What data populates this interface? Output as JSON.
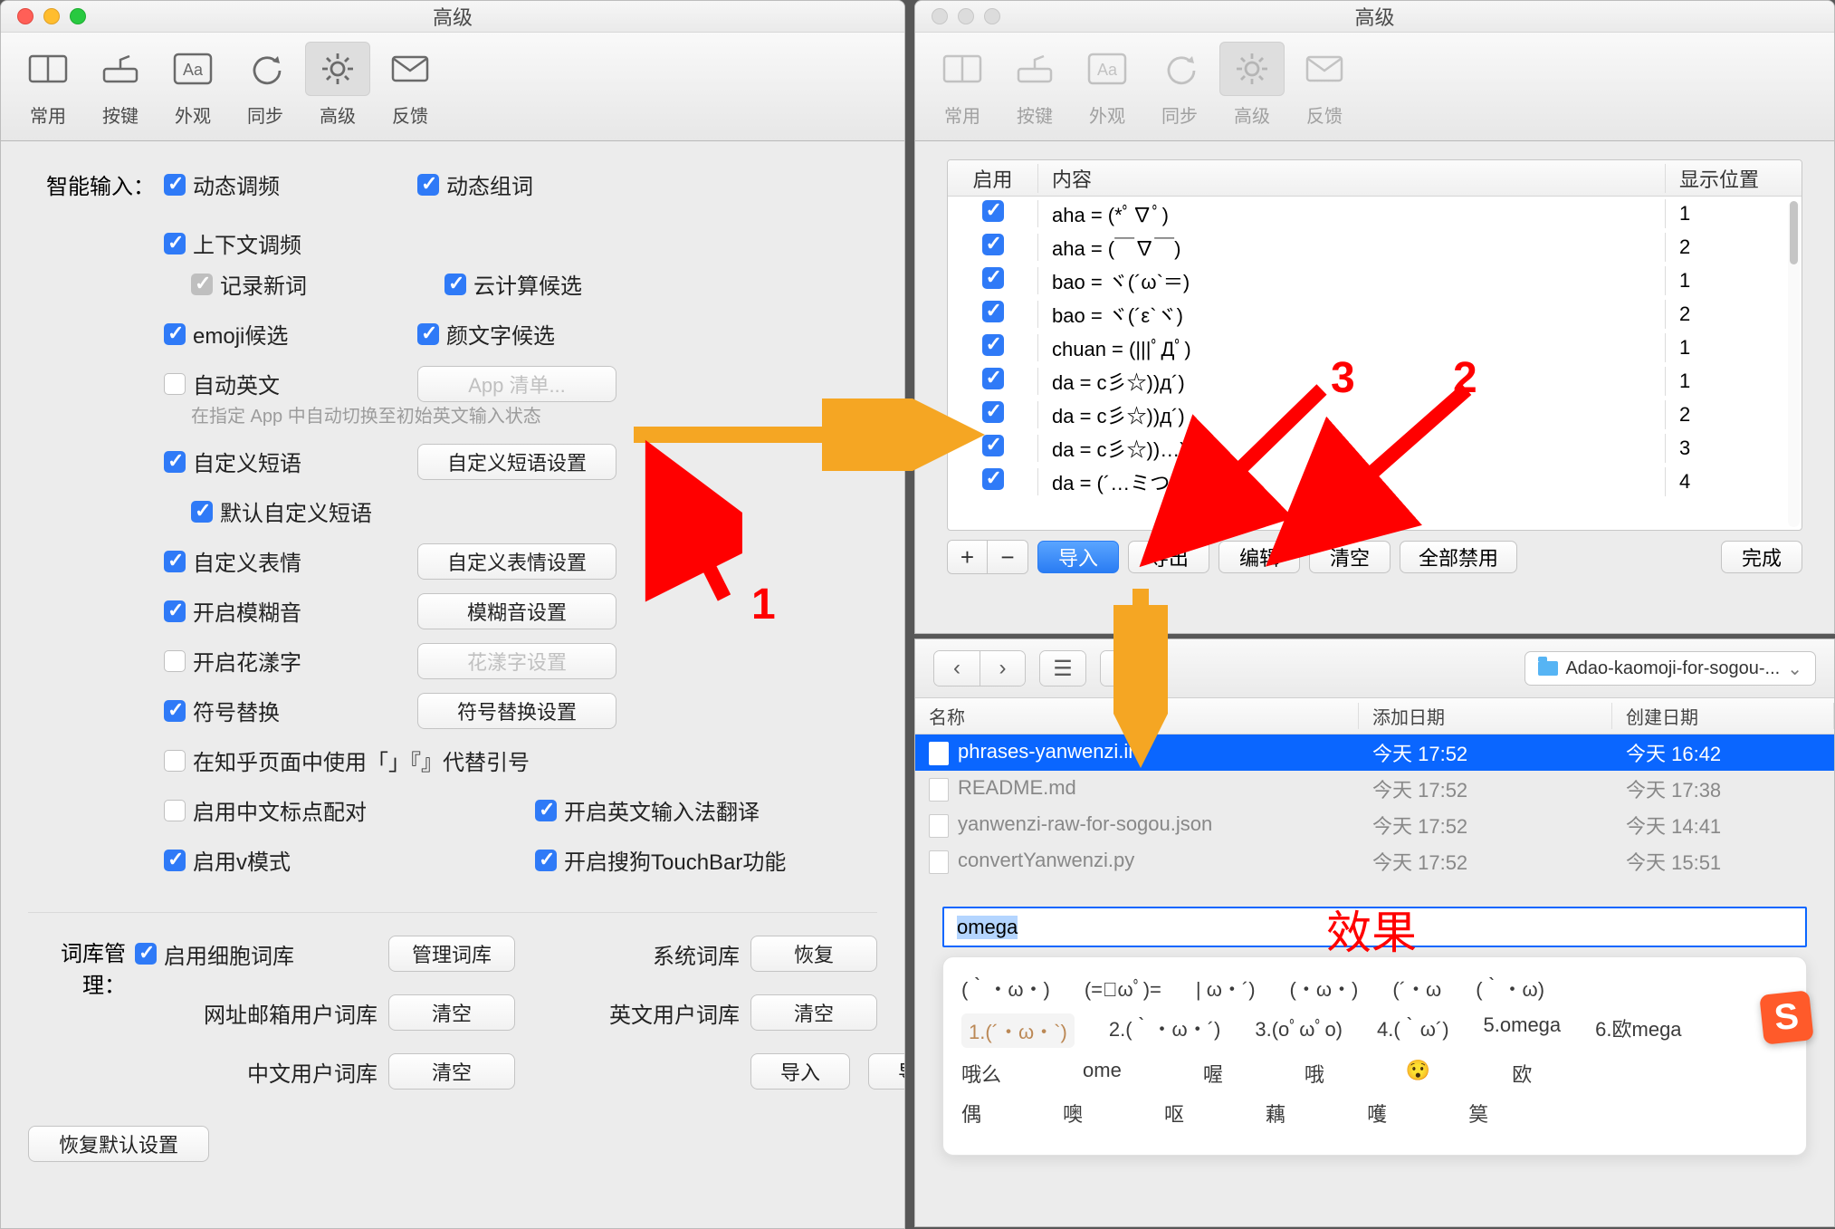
{
  "window_title": "高级",
  "toolbar": [
    {
      "key": "common",
      "label": "常用"
    },
    {
      "key": "keys",
      "label": "按键"
    },
    {
      "key": "appearance",
      "label": "外观"
    },
    {
      "key": "sync",
      "label": "同步"
    },
    {
      "key": "advanced",
      "label": "高级"
    },
    {
      "key": "feedback",
      "label": "反馈"
    }
  ],
  "toolbar_selected": "advanced",
  "smart_input": {
    "section_label": "智能输入：",
    "row1": [
      {
        "key": "dyntune",
        "label": "动态调频",
        "checked": true
      },
      {
        "key": "dynword",
        "label": "动态组词",
        "checked": true
      },
      {
        "key": "ctxtune",
        "label": "上下文调频",
        "checked": true
      }
    ],
    "row2": [
      {
        "key": "recnew",
        "label": "记录新词",
        "checked": true,
        "grey": true
      },
      {
        "key": "cloud",
        "label": "云计算候选",
        "checked": true
      }
    ],
    "row3": [
      {
        "key": "emoji",
        "label": "emoji候选",
        "checked": true
      },
      {
        "key": "kaomoji",
        "label": "颜文字候选",
        "checked": true
      }
    ],
    "auto_en": {
      "label": "自动英文",
      "checked": false,
      "btn": "App 清单...",
      "note": "在指定 App 中自动切换至初始英文输入状态"
    },
    "custom_phrase": {
      "label": "自定义短语",
      "checked": true,
      "btn": "自定义短语设置"
    },
    "default_phrase": {
      "label": "默认自定义短语",
      "checked": true
    },
    "custom_emoji": {
      "label": "自定义表情",
      "checked": true,
      "btn": "自定义表情设置"
    },
    "fuzzy": {
      "label": "开启模糊音",
      "checked": true,
      "btn": "模糊音设置"
    },
    "fancy": {
      "label": "开启花漾字",
      "checked": false,
      "btn": "花漾字设置"
    },
    "symbol": {
      "label": "符号替换",
      "checked": true,
      "btn": "符号替换设置"
    },
    "zhihu": {
      "label": "在知乎页面中使用「」『』代替引号",
      "checked": false
    },
    "pair": {
      "label": "启用中文标点配对",
      "checked": false
    },
    "trans": {
      "label": "开启英文输入法翻译",
      "checked": true
    },
    "vmode": {
      "label": "启用v模式",
      "checked": true
    },
    "touchbar": {
      "label": "开启搜狗TouchBar功能",
      "checked": true
    }
  },
  "dict": {
    "section_label": "词库管理：",
    "cell_lib": {
      "label": "启用细胞词库",
      "checked": true,
      "btn": "管理词库"
    },
    "sys_lib": {
      "label": "系统词库",
      "btn": "恢复"
    },
    "url_lib": {
      "label": "网址邮箱用户词库",
      "btn": "清空"
    },
    "en_lib": {
      "label": "英文用户词库",
      "btn": "清空"
    },
    "cn_lib": {
      "label": "中文用户词库",
      "btn": "清空"
    },
    "import": "导入",
    "export": "导出"
  },
  "restore_btn": "恢复默认设置",
  "phrase_table": {
    "headers": {
      "enable": "启用",
      "content": "内容",
      "pos": "显示位置"
    },
    "rows": [
      {
        "enabled": true,
        "content": "aha = (*ﾟ∇ﾟ)",
        "pos": "1"
      },
      {
        "enabled": true,
        "content": "aha = (￣∇￣)",
        "pos": "2"
      },
      {
        "enabled": true,
        "content": "bao = ヾ(´ω`＝)",
        "pos": "1"
      },
      {
        "enabled": true,
        "content": "bao = ヾ(´ε`ヾ)",
        "pos": "2"
      },
      {
        "enabled": true,
        "content": "chuan = (|||ﾟДﾟ)",
        "pos": "1"
      },
      {
        "enabled": true,
        "content": "da = c彡☆))д´)",
        "pos": "1"
      },
      {
        "enabled": true,
        "content": "da = c彡☆))д´)",
        "pos": "2"
      },
      {
        "enabled": true,
        "content": "da = c彡☆))…)",
        "pos": "3"
      },
      {
        "enabled": true,
        "content": "da = (´…ミつ",
        "pos": "4"
      }
    ],
    "buttons": {
      "import": "导入",
      "export": "导出",
      "edit": "编辑",
      "clear": "清空",
      "disable_all": "全部禁用",
      "done": "完成"
    }
  },
  "file_browser": {
    "path": "Adao-kaomoji-for-sogou-...",
    "headers": {
      "name": "名称",
      "added": "添加日期",
      "created": "创建日期"
    },
    "files": [
      {
        "name": "phrases-yanwenzi.ini",
        "added": "今天 17:52",
        "created": "今天 16:42",
        "selected": true
      },
      {
        "name": "README.md",
        "added": "今天 17:52",
        "created": "今天 17:38",
        "selected": false
      },
      {
        "name": "yanwenzi-raw-for-sogou.json",
        "added": "今天 17:52",
        "created": "今天 14:41",
        "selected": false
      },
      {
        "name": "convertYanwenzi.py",
        "added": "今天 17:52",
        "created": "今天 15:51",
        "selected": false
      }
    ]
  },
  "effect": {
    "label": "效果",
    "search_text": "omega",
    "row1": [
      "(｀・ω・)",
      "(=ﾟωﾟ)=",
      "| ω・´)",
      "(・ω・)",
      "(´・ω",
      "(｀・ω)"
    ],
    "row2": [
      "1.(´・ω・`)",
      "2.(｀・ω・´)",
      "3.(oﾟωﾟo)",
      "4.(｀ω´)",
      "5.omega",
      "6.欧mega"
    ],
    "row3": [
      "哦么",
      "ome",
      "喔",
      "哦",
      "😯",
      "欧"
    ],
    "row4": [
      "偶",
      "噢",
      "呕",
      "藕",
      "嚄",
      "筽"
    ]
  },
  "annotations": {
    "n1": "1",
    "n2": "2",
    "n3": "3"
  }
}
